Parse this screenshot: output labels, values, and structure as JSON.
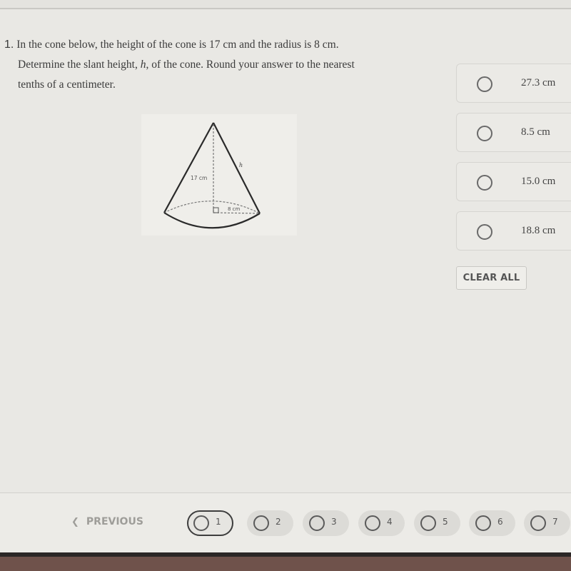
{
  "question": {
    "number": "1.",
    "line1": "In the cone below, the height of the cone is 17 cm and the radius is 8 cm.",
    "line2_before": "Determine the slant height, ",
    "line2_var": "h",
    "line2_after": ", of the cone.  Round your answer to the nearest",
    "line3": "tenths of a centimeter."
  },
  "figure": {
    "height_label": "17 cm",
    "radius_label": "8 cm",
    "slant_label": "h"
  },
  "answers": [
    {
      "label": "27.3 cm",
      "selected": false
    },
    {
      "label": "8.5 cm",
      "selected": false
    },
    {
      "label": "15.0 cm",
      "selected": false
    },
    {
      "label": "18.8 cm",
      "selected": false
    }
  ],
  "clear_all_label": "CLEAR ALL",
  "footer": {
    "previous_label": "PREVIOUS",
    "previous_icon": "chevron-left-icon",
    "pages": [
      {
        "number": "1",
        "current": true
      },
      {
        "number": "2",
        "current": false
      },
      {
        "number": "3",
        "current": false
      },
      {
        "number": "4",
        "current": false
      },
      {
        "number": "5",
        "current": false
      },
      {
        "number": "6",
        "current": false
      },
      {
        "number": "7",
        "current": false
      }
    ]
  }
}
